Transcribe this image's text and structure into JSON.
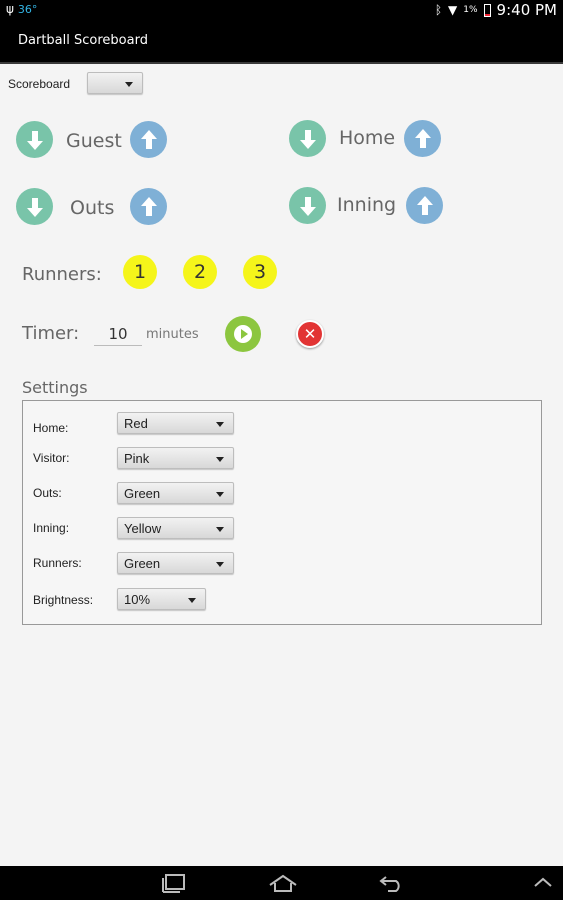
{
  "status_bar": {
    "temperature": "36°",
    "battery": "1%",
    "time": "9:40 PM"
  },
  "app": {
    "title": "Dartball Scoreboard"
  },
  "scoreboard": {
    "label": "Scoreboard",
    "selected": ""
  },
  "counters": {
    "guest": "Guest",
    "home": "Home",
    "outs": "Outs",
    "inning": "Inning"
  },
  "runners": {
    "label": "Runners:",
    "bases": [
      "1",
      "2",
      "3"
    ],
    "color": "#f5f51a"
  },
  "timer": {
    "label": "Timer:",
    "value": "10",
    "unit": "minutes"
  },
  "settings": {
    "title": "Settings",
    "rows": [
      {
        "label": "Home:",
        "value": "Red"
      },
      {
        "label": "Visitor:",
        "value": "Pink"
      },
      {
        "label": "Outs:",
        "value": "Green"
      },
      {
        "label": "Inning:",
        "value": "Yellow"
      },
      {
        "label": "Runners:",
        "value": "Green"
      },
      {
        "label": "Brightness:",
        "value": "10%"
      }
    ]
  },
  "colors": {
    "down_button": "#79c4a9",
    "up_button": "#7fb0d6",
    "play_button": "#8cc63f",
    "stop_button": "#e23434"
  },
  "icons": {
    "down": "arrow-down-icon",
    "up": "arrow-up-icon",
    "play": "play-icon",
    "stop": "close-icon",
    "nav_recent": "recent-apps-icon",
    "nav_home": "home-icon",
    "nav_back": "back-icon",
    "nav_menu": "chevron-up-icon"
  }
}
